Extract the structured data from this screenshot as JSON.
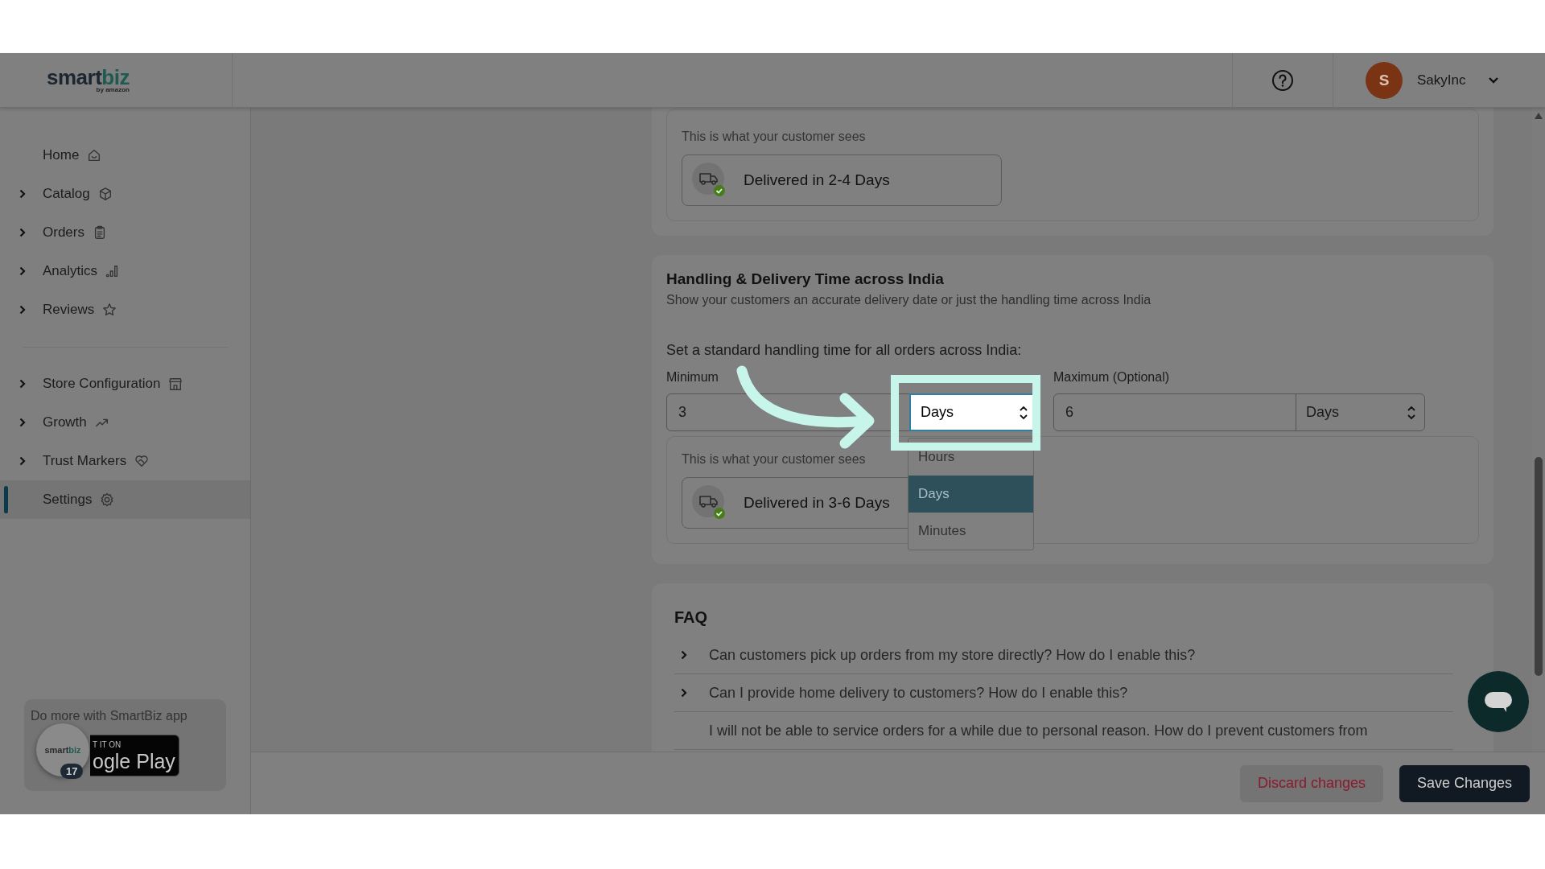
{
  "spotlight": true,
  "header": {
    "logo": {
      "main": "smart",
      "accent": "biz",
      "sub": "by amazon"
    },
    "user": {
      "initial": "S",
      "name": "SakyInc"
    }
  },
  "sidebar": {
    "groups": [
      [
        {
          "label": "Home",
          "expandable": false,
          "selected": false
        },
        {
          "label": "Catalog",
          "expandable": true,
          "selected": false
        },
        {
          "label": "Orders",
          "expandable": true,
          "selected": false
        },
        {
          "label": "Analytics",
          "expandable": true,
          "selected": false
        },
        {
          "label": "Reviews",
          "expandable": true,
          "selected": false
        }
      ],
      [
        {
          "label": "Store Configuration",
          "expandable": true,
          "selected": false
        },
        {
          "label": "Growth",
          "expandable": true,
          "selected": false
        },
        {
          "label": "Trust Markers",
          "expandable": true,
          "selected": false
        },
        {
          "label": "Settings",
          "expandable": false,
          "selected": true
        }
      ]
    ],
    "promo": {
      "title": "Do more with SmartBiz app",
      "store_badge": {
        "line1": "T IT ON",
        "line2": "ogle Play"
      },
      "app_icon": {
        "main": "smart",
        "accent": "biz",
        "count": "17"
      }
    }
  },
  "preview_top": {
    "caption": "This is what your customer sees",
    "text": "Delivered in 2-4 Days"
  },
  "handling": {
    "title": "Handling & Delivery Time across India",
    "subtitle": "Show your customers an accurate delivery date or just the handling time across India",
    "prompt": "Set a standard handling time for all orders across India:",
    "minimum": {
      "label": "Minimum",
      "value": "3",
      "unit": "Days",
      "open": true
    },
    "maximum": {
      "label": "Maximum (Optional)",
      "value": "6",
      "unit": "Days",
      "open": false
    },
    "dropdown": [
      {
        "label": "Hours",
        "selected": false
      },
      {
        "label": "Days",
        "selected": true
      },
      {
        "label": "Minutes",
        "selected": false
      }
    ],
    "preview": {
      "caption": "This is what your customer sees",
      "text": "Delivered in 3-6 Days"
    }
  },
  "faq": {
    "title": "FAQ",
    "items": [
      "Can customers pick up orders from my store directly? How do I enable this?",
      "Can I provide home delivery to customers? How do I enable this?",
      "I will not be able to service orders for a while due to personal reason. How do I prevent customers from"
    ]
  },
  "footer": {
    "buttons": [
      {
        "label": "Discard changes",
        "kind": "secondary"
      },
      {
        "label": "Save Changes",
        "kind": "primary"
      }
    ]
  }
}
